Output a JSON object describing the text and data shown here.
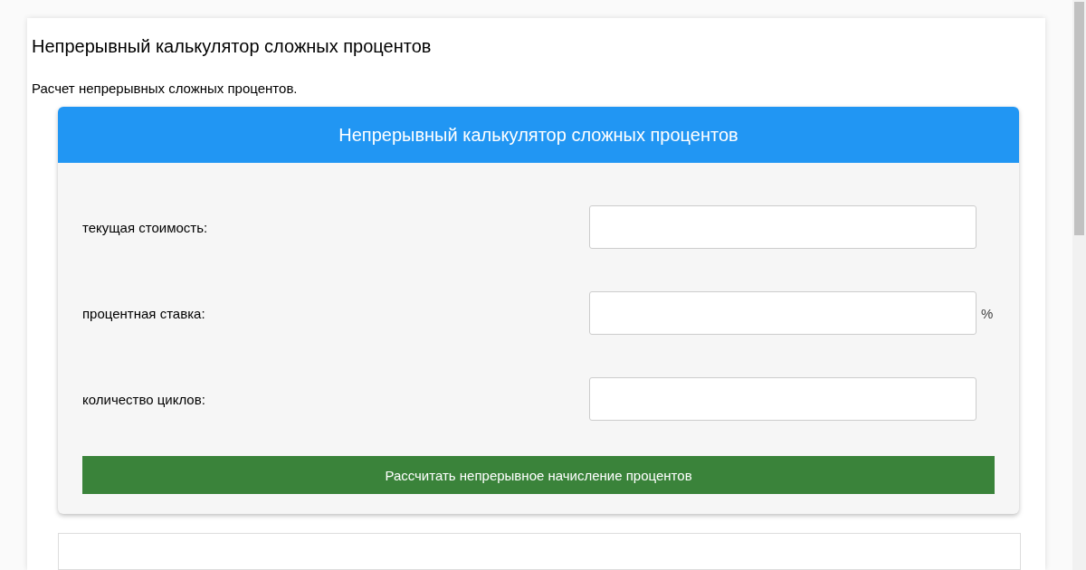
{
  "page": {
    "title": "Непрерывный калькулятор сложных процентов",
    "description": "Расчет непрерывных сложных процентов."
  },
  "calculator": {
    "title": "Непрерывный калькулятор сложных процентов",
    "fields": [
      {
        "label": "текущая стоимость:"
      },
      {
        "label": "процентная ставка:",
        "suffix": "%"
      },
      {
        "label": "количество циклов:"
      }
    ],
    "button": "Рассчитать непрерывное начисление процентов"
  }
}
